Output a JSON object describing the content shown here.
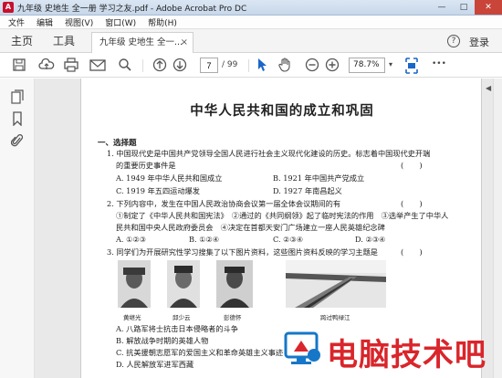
{
  "window": {
    "title": "九年级 史地生 全一册 学习之友.pdf - Adobe Acrobat Pro DC",
    "min": "—",
    "max": "□",
    "close": "✕"
  },
  "menu": [
    "文件",
    "编辑",
    "视图(V)",
    "窗口(W)",
    "帮助(H)"
  ],
  "tabs": {
    "home": "主页",
    "tools": "工具",
    "doc": "九年级 史地生 全一...",
    "close": "×",
    "help": "?",
    "signin": "登录"
  },
  "toolbar": {
    "page_current": "7",
    "page_total": "/ 99",
    "zoom": "78.7%",
    "zoom_arrow": "▾",
    "more": "•••"
  },
  "document": {
    "title": "中华人民共和国的成立和巩固",
    "section": "一、选择题",
    "questions": [
      {
        "lines": [
          "1. 中国现代史是中国共产党领导全国人民进行社会主义现代化建设的历史。标志着中国现代史开端",
          "的重要历史事件是"
        ],
        "paren": "(　　)",
        "options": [
          "A. 1949 年中华人民共和国成立",
          "B. 1921 年中国共产党成立",
          "C. 1919 年五四运动爆发",
          "D. 1927 年南昌起义"
        ]
      },
      {
        "lines": [
          "2. 下列内容中，发生在中国人民政治协商会议第一届全体会议期间的有",
          "①制定了《中华人民共和国宪法》　②通过的《共同纲领》起了临时宪法的作用　③选举产生了中华人",
          "民共和国中央人民政府委员会　④决定在首都天安门广场建立一座人民英雄纪念碑"
        ],
        "paren": "(　　)",
        "options": [
          "A. ①②③",
          "B. ①②④",
          "C. ②③④",
          "D. ②③④"
        ]
      },
      {
        "lines": [
          "3. 同学们为开展研究性学习搜集了以下图片资料，这些图片资料反映的学习主题是"
        ],
        "paren": "(　　)",
        "captions": [
          "黄继光",
          "邱少云",
          "彭德怀",
          "跨过鸭绿江"
        ],
        "options": [
          "A. 八路军将士抗击日本侵略者的斗争",
          "B. 解放战争时期的英雄人物",
          "C. 抗美援朝志愿军的爱国主义和革命英雄主义事迹",
          "D. 人民解放军进军西藏"
        ]
      }
    ]
  },
  "watermark": {
    "text": "电脑技术吧"
  }
}
